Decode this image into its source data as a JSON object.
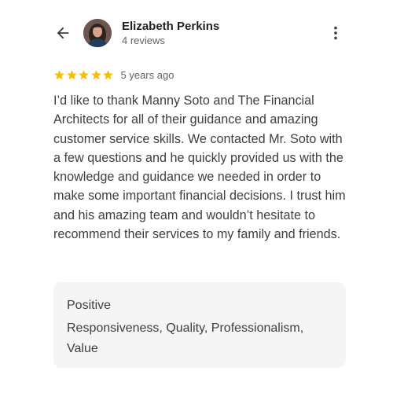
{
  "reviewer": {
    "name": "Elizabeth Perkins",
    "review_count": "4 reviews"
  },
  "review": {
    "rating": 5,
    "rating_max": 5,
    "star_color": "#fbbc04",
    "time_ago": "5 years ago",
    "text": "I’d like to thank Manny Soto and The Financial Architects for all of their guidance and amazing customer service skills. We contacted Mr. Soto with a few questions and he quickly provided us with the knowledge and guidance we needed in order to make some important financial decisions. I trust him and his amazing team and wouldn’t hesitate to recommend their services to my family and friends."
  },
  "highlights": {
    "title": "Positive",
    "items": "Responsiveness, Quality, Professionalism, Value"
  },
  "icons": {
    "back": "arrow-back-icon",
    "menu": "more-vertical-icon",
    "star": "star-icon"
  }
}
